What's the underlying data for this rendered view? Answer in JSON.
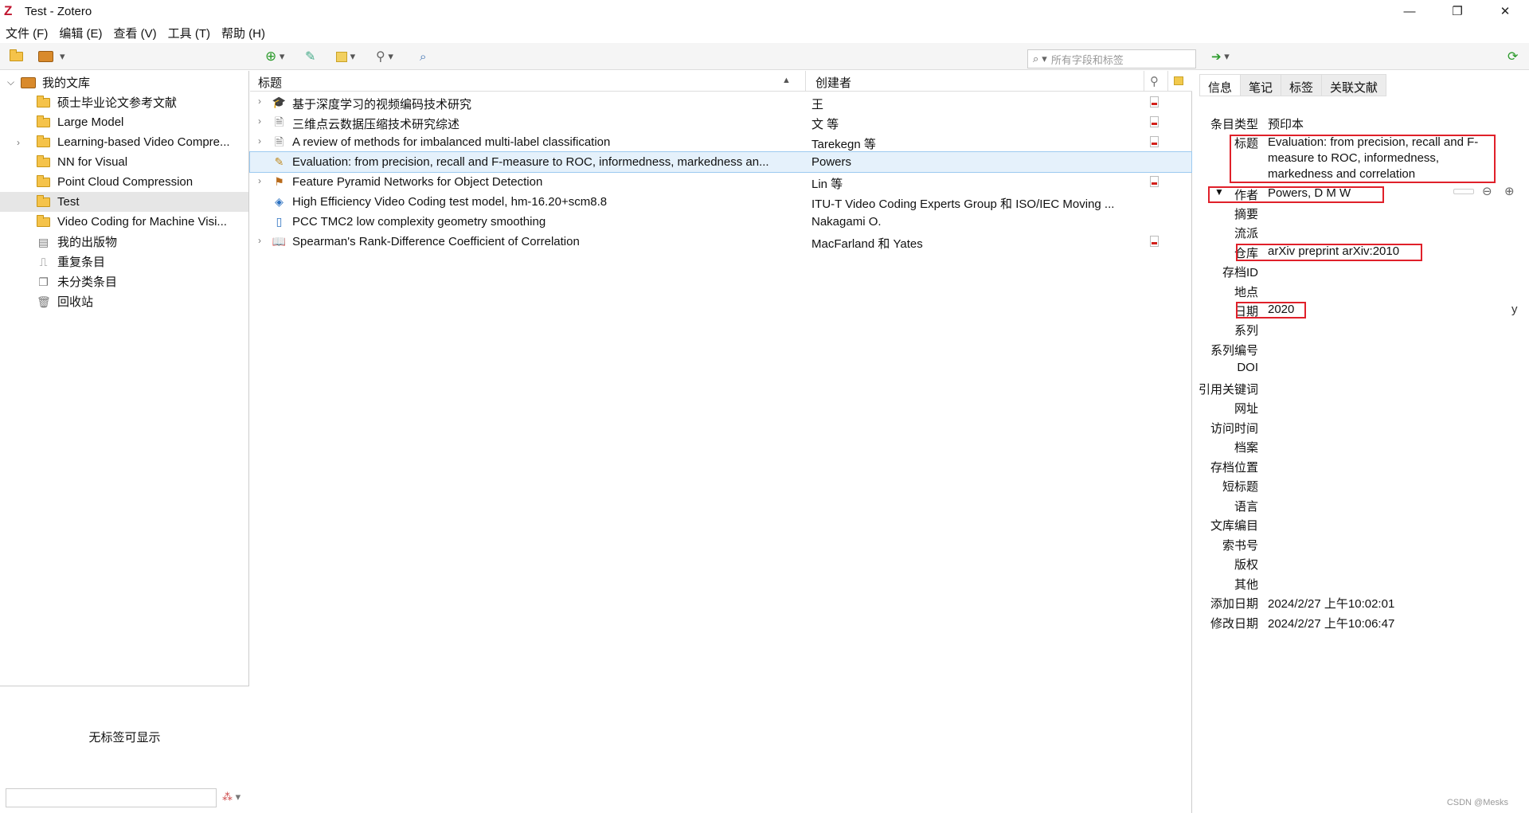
{
  "window": {
    "title": "Test - Zotero",
    "minimize": "—",
    "maximize": "❐",
    "close": "✕"
  },
  "menu": [
    "文件 (F)",
    "编辑 (E)",
    "查看 (V)",
    "工具 (T)",
    "帮助 (H)"
  ],
  "toolbar": {
    "search_placeholder": "所有字段和标签"
  },
  "library": {
    "root": "我的文库",
    "collections": [
      "硕士毕业论文参考文献",
      "Large Model",
      "Learning-based Video Compre...",
      "NN for Visual",
      "Point Cloud Compression",
      "Test",
      "Video Coding for Machine Visi..."
    ],
    "selected": "Test",
    "special": [
      "我的出版物",
      "重复条目",
      "未分类条目",
      "回收站"
    ]
  },
  "tags": {
    "empty_message": "无标签可显示"
  },
  "items": {
    "columns": {
      "title": "标题",
      "creator": "创建者"
    },
    "rows": [
      {
        "title": "基于深度学习的视频编码技术研究",
        "creator": "王",
        "icon": "thesis-icon",
        "twisty": true,
        "pdf": true
      },
      {
        "title": "三维点云数据压缩技术研究综述",
        "creator": "文 等",
        "icon": "document-icon",
        "twisty": true,
        "pdf": true
      },
      {
        "title": "A review of methods for imbalanced multi-label classification",
        "creator": "Tarekegn 等",
        "icon": "document-icon",
        "twisty": true,
        "pdf": true
      },
      {
        "title": "Evaluation: from precision, recall and F-measure to ROC, informedness, markedness an...",
        "creator": "Powers",
        "icon": "preprint-icon",
        "twisty": false,
        "pdf": false,
        "selected": true
      },
      {
        "title": "Feature Pyramid Networks for Object Detection",
        "creator": "Lin 等",
        "icon": "conference-paper-icon",
        "twisty": true,
        "pdf": true
      },
      {
        "title": "High Efficiency Video Coding test model, hm-16.20+scm8.8",
        "creator": "ITU-T Video Coding Experts Group 和 ISO/IEC Moving ...",
        "icon": "software-icon",
        "twisty": false,
        "pdf": false
      },
      {
        "title": "PCC TMC2 low complexity geometry smoothing",
        "creator": "Nakagami O.",
        "icon": "report-icon",
        "twisty": false,
        "pdf": false
      },
      {
        "title": "Spearman's Rank-Difference Coefficient of Correlation",
        "creator": "MacFarland 和 Yates",
        "icon": "book-icon",
        "twisty": true,
        "pdf": true
      }
    ]
  },
  "detail": {
    "tabs": [
      "信息",
      "笔记",
      "标签",
      "关联文献"
    ],
    "fields": [
      {
        "label": "条目类型",
        "value": "预印本"
      },
      {
        "label": "标题",
        "value": "Evaluation: from precision, recall and F-measure to ROC, informedness, markedness and correlation"
      },
      {
        "label": "作者",
        "value": "Powers, D M W"
      },
      {
        "label": "摘要",
        "value": ""
      },
      {
        "label": "流派",
        "value": ""
      },
      {
        "label": "仓库",
        "value": "arXiv preprint arXiv:2010"
      },
      {
        "label": "存档ID",
        "value": ""
      },
      {
        "label": "地点",
        "value": ""
      },
      {
        "label": "日期",
        "value": "2020",
        "extra": "y"
      },
      {
        "label": "系列",
        "value": ""
      },
      {
        "label": "系列编号",
        "value": ""
      },
      {
        "label": "DOI",
        "value": ""
      },
      {
        "label": "引用关键词",
        "value": ""
      },
      {
        "label": "网址",
        "value": ""
      },
      {
        "label": "访问时间",
        "value": ""
      },
      {
        "label": "档案",
        "value": ""
      },
      {
        "label": "存档位置",
        "value": ""
      },
      {
        "label": "短标题",
        "value": ""
      },
      {
        "label": "语言",
        "value": ""
      },
      {
        "label": "文库编目",
        "value": ""
      },
      {
        "label": "索书号",
        "value": ""
      },
      {
        "label": "版权",
        "value": ""
      },
      {
        "label": "其他",
        "value": ""
      },
      {
        "label": "添加日期",
        "value": "2024/2/27 上午10:02:01"
      },
      {
        "label": "修改日期",
        "value": "2024/2/27 上午10:06:47"
      }
    ]
  },
  "watermark": "CSDN @Mesks",
  "colors": {
    "highlight": "#e0202a",
    "selected_row": "#e5f1fb",
    "folder": "#f5c34a"
  }
}
